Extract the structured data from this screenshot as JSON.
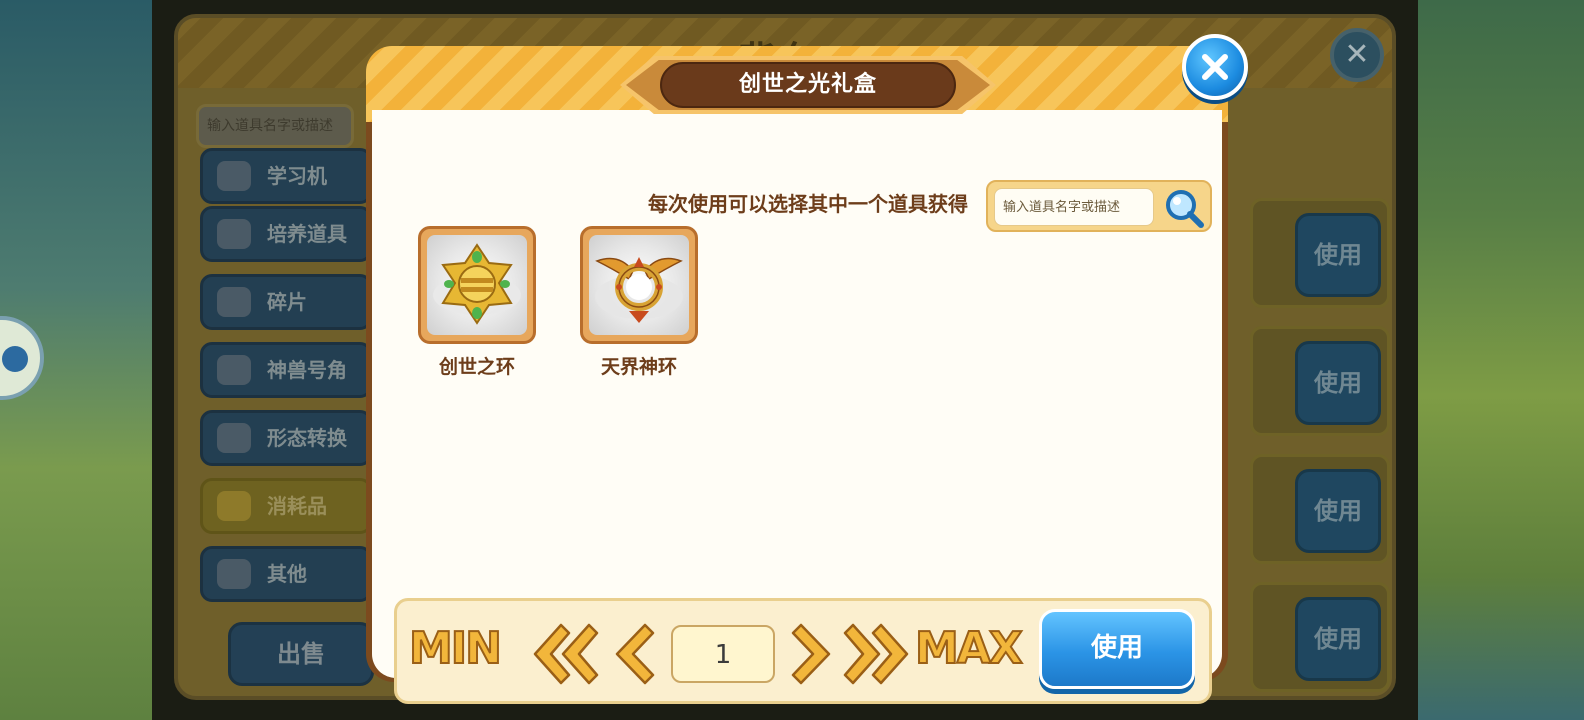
{
  "background_window": {
    "title": "背包",
    "search_placeholder": "输入道具名字或描述",
    "categories": [
      {
        "label": "学习机",
        "icon": "learning-machine-icon",
        "active": false
      },
      {
        "label": "培养道具",
        "icon": "training-items-icon",
        "active": false
      },
      {
        "label": "碎片",
        "icon": "puzzle-piece-icon",
        "active": false
      },
      {
        "label": "神兽号角",
        "icon": "horn-icon",
        "active": false
      },
      {
        "label": "形态转换",
        "icon": "feather-icon",
        "active": false
      },
      {
        "label": "消耗品",
        "icon": "box-icon",
        "active": true
      },
      {
        "label": "其他",
        "icon": "magnifier-icon",
        "active": false
      }
    ],
    "sell_label": "出售",
    "use_buttons": [
      "使用",
      "使用",
      "使用",
      "使用"
    ]
  },
  "modal": {
    "title": "创世之光礼盒",
    "subtitle": "每次使用可以选择其中一个道具获得",
    "search_placeholder": "输入道具名字或描述",
    "items": [
      {
        "name": "创世之环",
        "icon": "genesis-ring-icon"
      },
      {
        "name": "天界神环",
        "icon": "celestial-ring-icon"
      }
    ],
    "quantity": {
      "min_label": "MIN",
      "max_label": "MAX",
      "value": "1"
    },
    "use_label": "使用"
  },
  "colors": {
    "header_stripe": "#f3b23a",
    "title_pill": "#6a3a1b",
    "text_brown": "#6d3d1a",
    "use_button_blue": "#2b94e6",
    "arrow_gold": "#f2b63b"
  }
}
